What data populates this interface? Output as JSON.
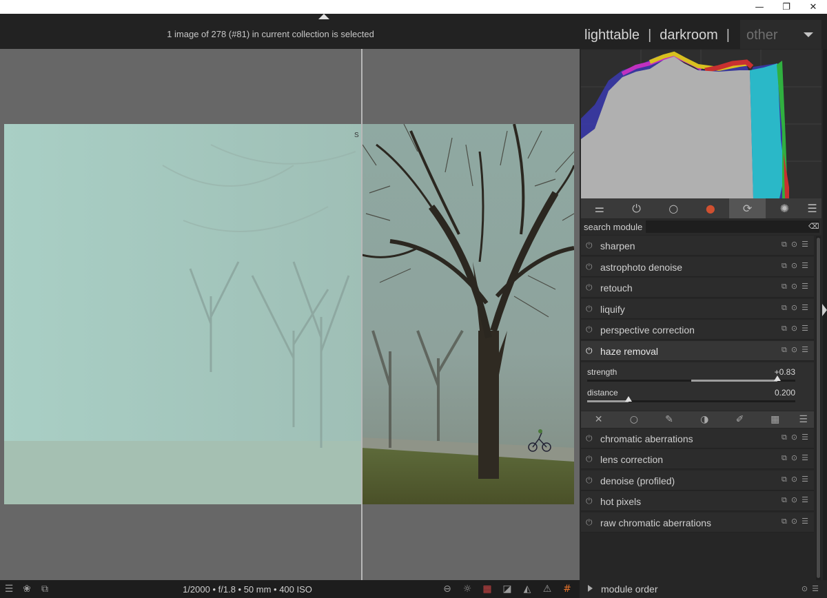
{
  "window": {
    "minimize": "—",
    "restore": "❐",
    "close": "✕"
  },
  "header": {
    "selection_info": "1 image of 278 (#81) in current collection is selected",
    "views": {
      "lighttable": "lighttable",
      "darkroom": "darkroom",
      "separator": "|",
      "other": "other"
    }
  },
  "image": {
    "split_marker": "S"
  },
  "module_groups": [
    {
      "icon": "sliders-icon",
      "glyph": "⚌"
    },
    {
      "icon": "power-icon",
      "glyph": "⏻"
    },
    {
      "icon": "circle-icon",
      "glyph": "○"
    },
    {
      "icon": "color-wheel-icon",
      "glyph": "●"
    },
    {
      "icon": "refresh-icon",
      "glyph": "⟳",
      "active": true
    },
    {
      "icon": "aperture-icon",
      "glyph": "✺"
    },
    {
      "icon": "menu-icon",
      "glyph": "☰"
    }
  ],
  "search": {
    "label": "search module",
    "value": "",
    "clear_glyph": "⌫"
  },
  "modules_top": [
    {
      "name": "sharpen"
    },
    {
      "name": "astrophoto denoise"
    },
    {
      "name": "retouch"
    },
    {
      "name": "liquify"
    },
    {
      "name": "perspective correction"
    },
    {
      "name": "haze removal",
      "expanded": true
    }
  ],
  "haze_removal": {
    "strength": {
      "label": "strength",
      "value": "+0.83",
      "level": 0.83
    },
    "distance": {
      "label": "distance",
      "value": "0.200",
      "level": 0.2
    }
  },
  "mask_icons": [
    {
      "icon": "mask-off-icon",
      "glyph": "✕"
    },
    {
      "icon": "mask-uniform-icon",
      "glyph": "○"
    },
    {
      "icon": "mask-drawn-icon",
      "glyph": "✎"
    },
    {
      "icon": "mask-parametric-icon",
      "glyph": "◑"
    },
    {
      "icon": "mask-drawn-parametric-icon",
      "glyph": "✐"
    },
    {
      "icon": "mask-raster-icon",
      "glyph": "▦"
    },
    {
      "icon": "mask-menu-icon",
      "glyph": "☰"
    }
  ],
  "modules_bottom": [
    {
      "name": "chromatic aberrations"
    },
    {
      "name": "lens correction"
    },
    {
      "name": "denoise (profiled)"
    },
    {
      "name": "hot pixels"
    },
    {
      "name": "raw chromatic aberrations"
    }
  ],
  "module_actions": {
    "presets": "⧉",
    "reset": "⊙",
    "menu": "☰"
  },
  "bottom": {
    "exif": "1/2000 • f/1.8 • 50 mm • 400 ISO",
    "module_order": "module order"
  },
  "bottom_icons_left": [
    {
      "icon": "menu-icon",
      "glyph": "☰"
    },
    {
      "icon": "styles-icon",
      "glyph": "❀"
    },
    {
      "icon": "second-window-icon",
      "glyph": "⧉"
    }
  ],
  "bottom_icons_right": [
    {
      "icon": "focus-peaking-icon",
      "glyph": "⊖"
    },
    {
      "icon": "bulb-icon",
      "glyph": "☼"
    },
    {
      "icon": "color-assessment-icon",
      "glyph": "▦"
    },
    {
      "icon": "softproof-icon",
      "glyph": "◪"
    },
    {
      "icon": "gamut-check-icon",
      "glyph": "◭"
    },
    {
      "icon": "warning-icon",
      "glyph": "⚠"
    },
    {
      "icon": "guides-icon",
      "glyph": "#"
    }
  ],
  "colors": {
    "accent_orange": "#e0702a",
    "panel_bg": "#262626",
    "center_bg": "#676767"
  }
}
